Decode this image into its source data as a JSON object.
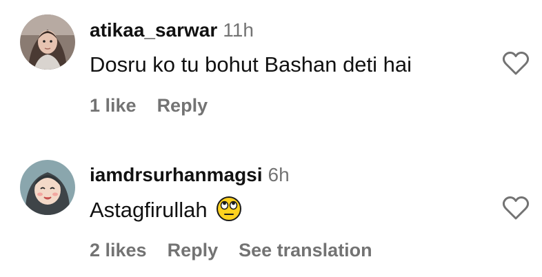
{
  "comments": [
    {
      "username": "atikaa_sarwar",
      "time": "11h",
      "text": "Dosru ko tu bohut Bashan deti hai",
      "likes": "1 like",
      "reply": "Reply",
      "avatar_icon": "user-avatar-photo",
      "like_icon": "heart-outline-icon"
    },
    {
      "username": "iamdrsurhanmagsi",
      "time": "6h",
      "text": "Astagfirullah",
      "emoji": "face-with-rolling-eyes",
      "likes": "2 likes",
      "reply": "Reply",
      "translate": "See translation",
      "avatar_icon": "user-avatar-illustration",
      "like_icon": "heart-outline-icon"
    }
  ],
  "colors": {
    "secondary_text": "#737373",
    "primary_text": "#111111",
    "background": "#ffffff"
  }
}
